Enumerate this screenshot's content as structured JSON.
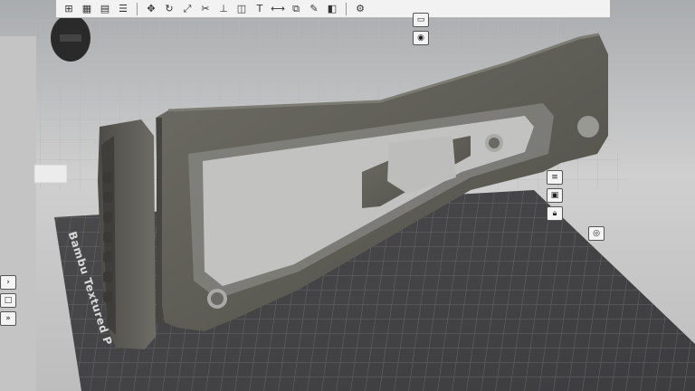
{
  "scene": {
    "background": "#c9c9c9",
    "build_plate_label": "Bambu Textured P"
  },
  "toolbar": {
    "icons": [
      "add-plate-icon",
      "grid-icon",
      "layout-icon",
      "list-icon",
      "move-icon",
      "rotate-icon",
      "scale-icon",
      "cut-icon",
      "support-icon",
      "seam-icon",
      "text-icon",
      "measure-icon",
      "assembly-icon",
      "color-paint-icon",
      "fuzzy-icon",
      "settings-icon"
    ]
  },
  "right_panel": {
    "icons": [
      "plate-icon",
      "eye-icon",
      "lock-icon",
      "target-icon"
    ]
  },
  "lower_right_panel": {
    "icons": [
      "layers-icon",
      "box-icon",
      "lock-icon",
      "target-icon"
    ]
  },
  "left_panel": {
    "icons": [
      "chevron-icon",
      "box-icon",
      "arrow-icon"
    ]
  }
}
